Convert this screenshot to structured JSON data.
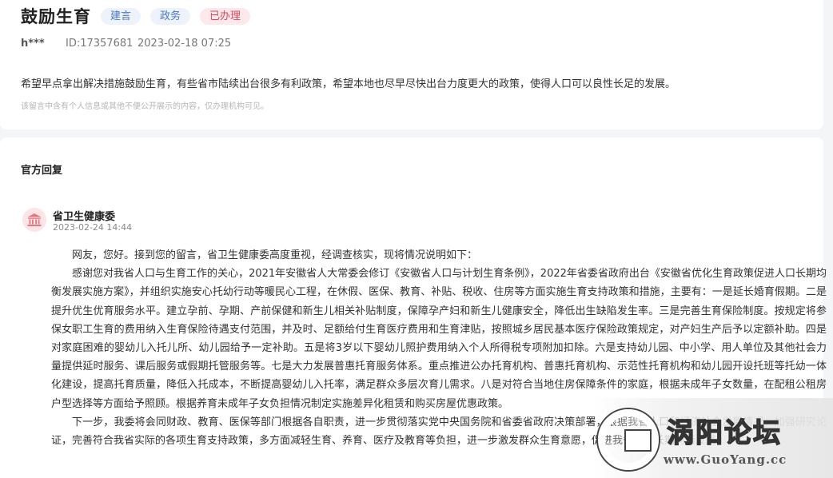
{
  "message": {
    "title": "鼓励生育",
    "tags": [
      {
        "label": "建言",
        "color": "#4a78c2"
      },
      {
        "label": "政务",
        "color": "#4a78c2"
      },
      {
        "label": "已办理",
        "color": "#e2455f"
      }
    ],
    "author": "h***",
    "id_text": "ID:17357681",
    "datetime": "2023-02-18 07:25",
    "content": "希望早点拿出解决措施鼓励生育，有些省市陆续出台很多有利政策，希望本地也尽早尽快出台力度更大的政策，使得人口可以良性长足的发展。",
    "privacy_notice": "该留言中含有个人信息或其他不便公开展示的内容，仅办理机构可见。"
  },
  "reply": {
    "section_title": "官方回复",
    "org_name": "省卫生健康委",
    "org_icon": "government-building-icon",
    "date": "2023-02-24 14:44",
    "paragraphs": [
      "网友，您好。接到您的留言，省卫生健康委高度重视，经调查核实，现将情况说明如下：",
      "感谢您对我省人口与生育工作的关心，2021年安徽省人大常委会修订《安徽省人口与计划生育条例》，2022年省委省政府出台《安徽省优化生育政策促进人口长期均衡发展实施方案》，并组织实施安心托幼行动等暖民心工程，在休假、医保、教育、补贴、税收、住房等方面实施生育支持政策和措施，主要有：一是延长婚育假期。二是提升优生优育服务水平。建立孕前、孕期、产前保健和新生儿相关补贴制度，保障孕产妇和新生儿健康安全，降低出生缺陷发生率。三是完善生育保险制度。按规定将参保女职工生育的费用纳入生育保险待遇支付范围，并及时、足额给付生育医疗费用和生育津贴，按照城乡居民基本医疗保险政策规定，对产妇生产后予以定额补助。四是对家庭困难的婴幼儿入托儿所、幼儿园给予一定补助。五是将3岁以下婴幼儿照护费用纳入个人所得税专项附加扣除。六是支持幼儿园、中小学、用人单位及其他社会力量提供延时服务、课后服务或假期托管服务等。七是大力发展普惠托育服务体系。重点推进公办托育机构、普惠托育机构、示范性托育机构和幼儿园开设托班等托幼一体化建设，提高托育质量，降低入托成本，不断提高婴幼儿入托率，满足群众多层次育儿需求。八是对符合当地住房保障条件的家庭，根据未成年子女数量，在配租公租房户型选择等方面给予照顾。根据养育未成年子女负担情况制定实施差异化租赁和购买房屋优惠政策。",
      "下一步，我委将会同财政、教育、医保等部门根据各自职责，进一步贯彻落实党中央国务院和省委省政府决策部署，根据我省人口和经济社会发展情况，加强研究论证，完善符合我省实际的各项生育支持政策，多方面减轻生育、养育、医疗及教育等负担，进一步激发群众生育意愿，促进我省人口长期均衡发展。"
    ]
  },
  "watermark": {
    "text_cn": "涡阳论坛",
    "text_en": "www.GuoYang.cc"
  }
}
